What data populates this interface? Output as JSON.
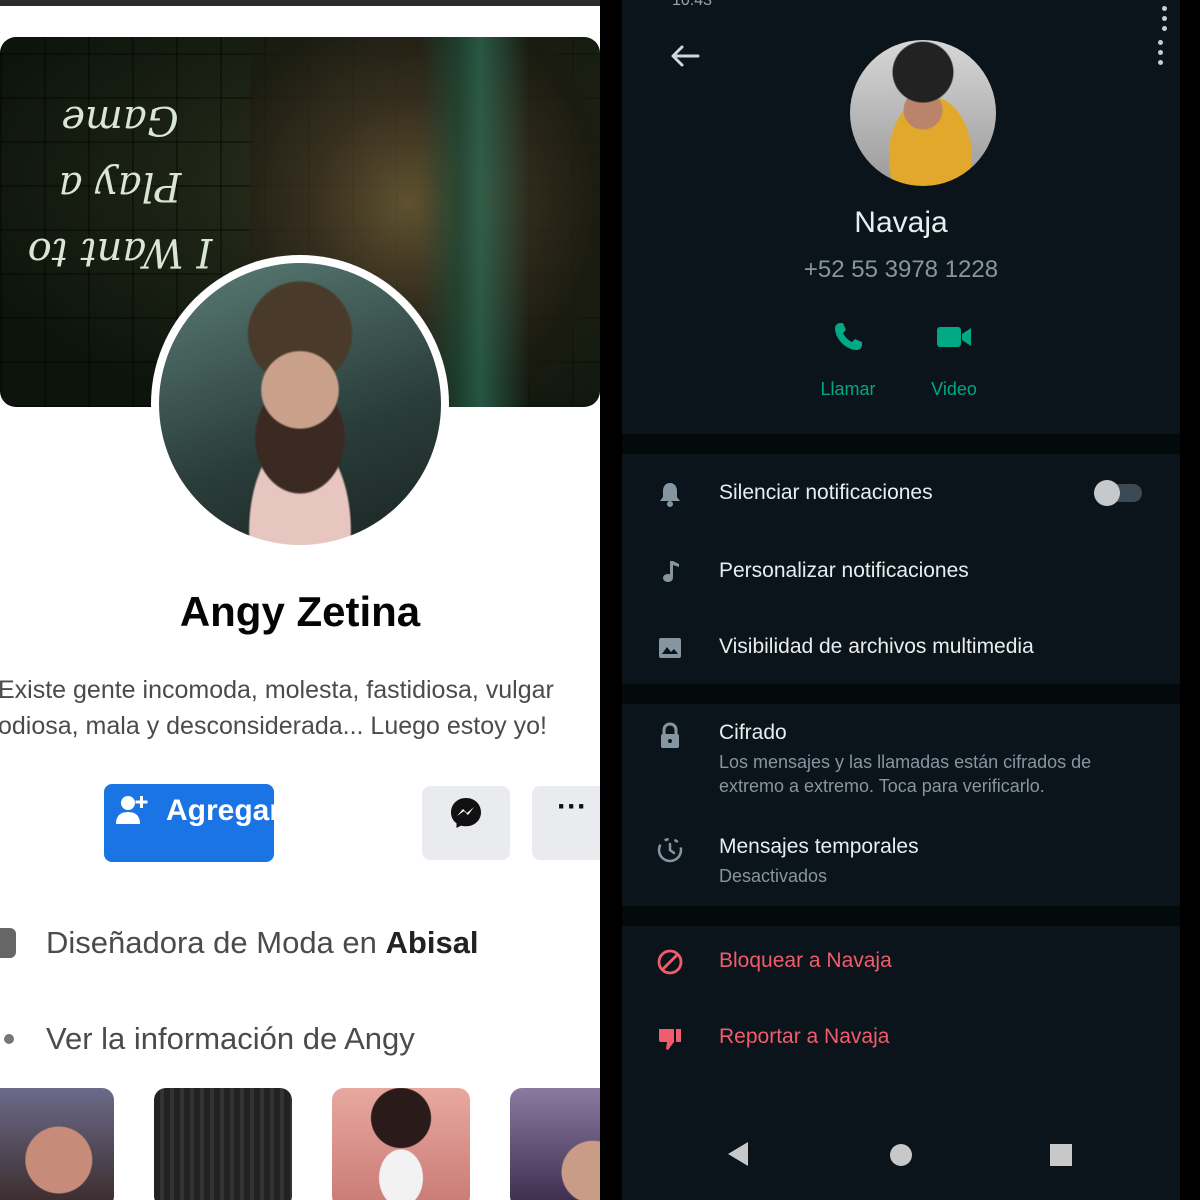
{
  "facebook": {
    "cover_text": "I Want to Play a Game",
    "profile_name": "Angy Zetina",
    "bio_line1": "Existe gente incomoda, molesta, fastidiosa, vulgar",
    "bio_line2": "odiosa, mala y desconsiderada... Luego estoy yo!",
    "add_button_label": "Agregar",
    "more_button_label": "···",
    "work_prefix": "Diseñadora de Moda en ",
    "work_company": "Abisal",
    "info_link": "Ver la información de Angy",
    "accent_color": "#1b74e4"
  },
  "whatsapp": {
    "status_time": "10:43",
    "contact_name": "Navaja",
    "phone": "+52 55 3978 1228",
    "actions": [
      {
        "label": "Llamar",
        "icon": "phone-icon"
      },
      {
        "label": "Video",
        "icon": "video-icon"
      }
    ],
    "settings": [
      {
        "label": "Silenciar notificaciones",
        "icon": "bell-icon"
      },
      {
        "label": "Personalizar notificaciones",
        "icon": "music-note-icon"
      },
      {
        "label": "Visibilidad de archivos multimedia",
        "icon": "image-icon"
      }
    ],
    "mute_enabled": false,
    "encryption": {
      "title": "Cifrado",
      "description": "Los mensajes y las llamadas están cifrados de extremo a extremo. Toca para verificarlo."
    },
    "disappearing": {
      "title": "Mensajes temporales",
      "status": "Desactivados"
    },
    "block_label": "Bloquear a Navaja",
    "report_label": "Reportar a Navaja",
    "accent_color": "#00a884",
    "danger_color": "#f15c6d"
  }
}
